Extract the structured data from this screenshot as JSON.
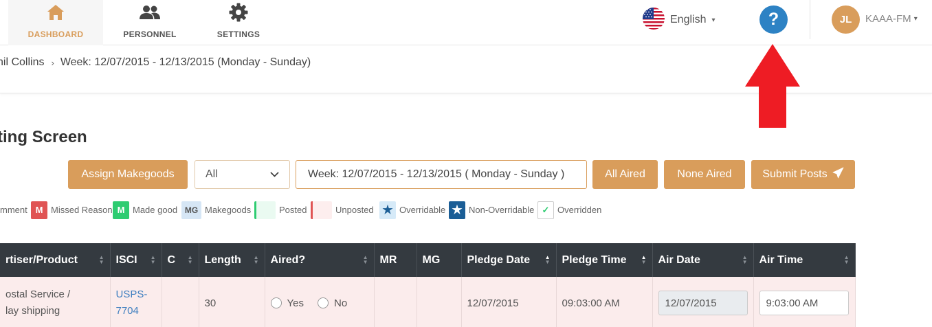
{
  "nav": {
    "items": [
      {
        "label": "DASHBOARD",
        "icon": "home-icon",
        "active": true
      },
      {
        "label": "PERSONNEL",
        "icon": "users-icon",
        "active": false
      },
      {
        "label": "SETTINGS",
        "icon": "gear-icon",
        "active": false
      }
    ],
    "language": "English",
    "help_symbol": "?",
    "user_initials": "JL",
    "station": "KAAA-FM"
  },
  "breadcrumb": {
    "items": [
      "hil Collins",
      "Week: 12/07/2015 - 12/13/2015 (Monday - Sunday)"
    ],
    "separator": "›"
  },
  "page": {
    "title": "ting Screen"
  },
  "controls": {
    "assign_makegoods": "Assign Makegoods",
    "filter_value": "All",
    "week_range": "Week: 12/07/2015 - 12/13/2015 ( Monday - Sunday )",
    "all_aired": "All Aired",
    "none_aired": "None Aired",
    "submit_posts": "Submit Posts"
  },
  "legend": [
    {
      "symbol": "",
      "label": "mment"
    },
    {
      "symbol": "M",
      "label": "Missed Reason",
      "color": "#e05454"
    },
    {
      "symbol": "M",
      "label": "Made good",
      "color": "#2ecc71"
    },
    {
      "symbol": "MG",
      "label": "Makegoods",
      "color": "#d6e6f5"
    },
    {
      "symbol": "",
      "label": "Posted",
      "color": "#eafaf1"
    },
    {
      "symbol": "",
      "label": "Unposted",
      "color": "#fdeeee"
    },
    {
      "symbol": "★",
      "label": "Overridable",
      "color": "#d6eaf8"
    },
    {
      "symbol": "★",
      "label": "Non-Overridable",
      "color": "#1b5e96"
    },
    {
      "symbol": "✓",
      "label": "Overridden",
      "color": "#ffffff"
    }
  ],
  "table": {
    "headers": [
      "rtiser/Product",
      "ISCI",
      "C",
      "Length",
      "Aired?",
      "MR",
      "MG",
      "Pledge Date",
      "Pledge Time",
      "Air Date",
      "Air Time"
    ],
    "rows": [
      {
        "advertiser_line1": "ostal Service /",
        "advertiser_line2": "lay shipping",
        "isci_line1": "USPS-",
        "isci_line2": "7704",
        "c": "",
        "length": "30",
        "aired_yes": "Yes",
        "aired_no": "No",
        "mr": "",
        "mg": "",
        "pledge_date": "12/07/2015",
        "pledge_time": "09:03:00 AM",
        "air_date": "12/07/2015",
        "air_time": "9:03:00 AM"
      }
    ]
  },
  "colors": {
    "accent": "#d99d5b",
    "help_blue": "#2d82c4",
    "header_dark": "#343a40",
    "row_unposted": "#fbecec",
    "annotation_red": "#ee1c24"
  }
}
